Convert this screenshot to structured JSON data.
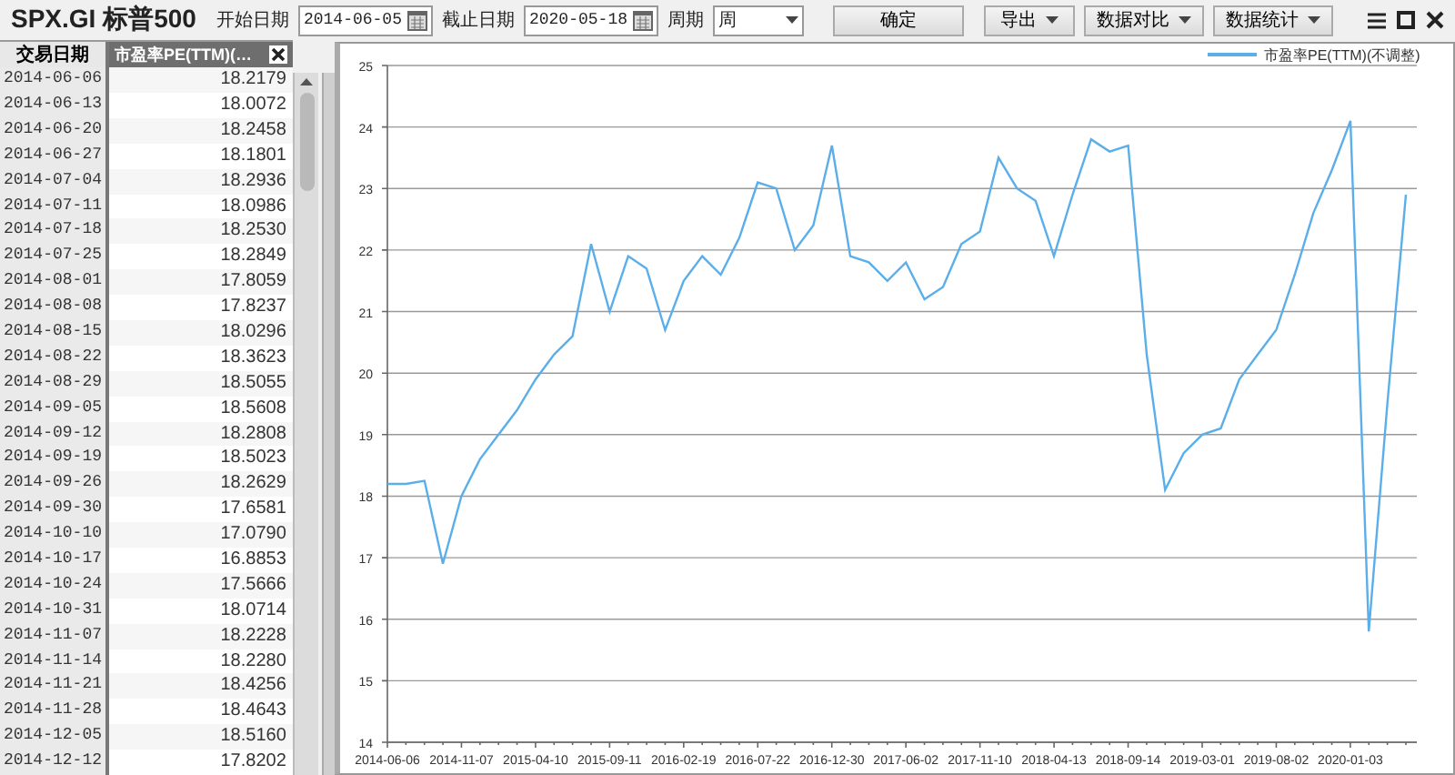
{
  "title": "SPX.GI 标普500",
  "toolbar": {
    "start_label": "开始日期",
    "start_value": "2014-06-05",
    "end_label": "截止日期",
    "end_value": "2020-05-18",
    "period_label": "周期",
    "period_value": "周",
    "buttons": [
      {
        "label": "确定",
        "dropdown": false
      },
      {
        "label": "导出",
        "dropdown": true
      },
      {
        "label": "数据对比",
        "dropdown": true
      },
      {
        "label": "数据统计",
        "dropdown": true
      }
    ]
  },
  "table": {
    "columns": [
      "交易日期",
      "市盈率PE(TTM)(…"
    ],
    "rows": [
      [
        "2014-06-06",
        "18.2179"
      ],
      [
        "2014-06-13",
        "18.0072"
      ],
      [
        "2014-06-20",
        "18.2458"
      ],
      [
        "2014-06-27",
        "18.1801"
      ],
      [
        "2014-07-04",
        "18.2936"
      ],
      [
        "2014-07-11",
        "18.0986"
      ],
      [
        "2014-07-18",
        "18.2530"
      ],
      [
        "2014-07-25",
        "18.2849"
      ],
      [
        "2014-08-01",
        "17.8059"
      ],
      [
        "2014-08-08",
        "17.8237"
      ],
      [
        "2014-08-15",
        "18.0296"
      ],
      [
        "2014-08-22",
        "18.3623"
      ],
      [
        "2014-08-29",
        "18.5055"
      ],
      [
        "2014-09-05",
        "18.5608"
      ],
      [
        "2014-09-12",
        "18.2808"
      ],
      [
        "2014-09-19",
        "18.5023"
      ],
      [
        "2014-09-26",
        "18.2629"
      ],
      [
        "2014-09-30",
        "17.6581"
      ],
      [
        "2014-10-10",
        "17.0790"
      ],
      [
        "2014-10-17",
        "16.8853"
      ],
      [
        "2014-10-24",
        "17.5666"
      ],
      [
        "2014-10-31",
        "18.0714"
      ],
      [
        "2014-11-07",
        "18.2228"
      ],
      [
        "2014-11-14",
        "18.2280"
      ],
      [
        "2014-11-21",
        "18.4256"
      ],
      [
        "2014-11-28",
        "18.4643"
      ],
      [
        "2014-12-05",
        "18.5160"
      ],
      [
        "2014-12-12",
        "17.8202"
      ]
    ]
  },
  "chart_data": {
    "type": "line",
    "grid": true,
    "ylim": [
      14,
      25
    ],
    "yticks": [
      14,
      15,
      16,
      17,
      18,
      19,
      20,
      21,
      22,
      23,
      24,
      25
    ],
    "categories": [
      "2014-06-06",
      null,
      null,
      null,
      "2014-11-07",
      null,
      null,
      null,
      "2015-04-10",
      null,
      null,
      null,
      "2015-09-11",
      null,
      null,
      null,
      "2016-02-19",
      null,
      null,
      null,
      "2016-07-22",
      null,
      null,
      null,
      "2016-12-30",
      null,
      null,
      null,
      "2017-06-02",
      null,
      null,
      null,
      "2017-11-10",
      null,
      null,
      null,
      "2018-04-13",
      null,
      null,
      null,
      "2018-09-14",
      null,
      null,
      null,
      "2019-03-01",
      null,
      null,
      null,
      "2019-08-02",
      null,
      null,
      null,
      "2020-01-03",
      null,
      null,
      null
    ],
    "series": [
      {
        "name": "市盈率PE(TTM)(不调整)",
        "color": "#5aaeea",
        "values": [
          18.2,
          18.2,
          18.25,
          16.9,
          18.0,
          18.6,
          19.0,
          19.4,
          19.9,
          20.3,
          20.6,
          22.1,
          21.0,
          21.9,
          21.7,
          20.7,
          21.5,
          21.9,
          21.6,
          22.2,
          23.1,
          23.0,
          22.0,
          22.4,
          23.7,
          21.9,
          21.8,
          21.5,
          21.8,
          21.2,
          21.4,
          22.1,
          22.3,
          23.5,
          23.0,
          22.8,
          21.9,
          22.9,
          23.8,
          23.6,
          23.7,
          20.3,
          18.1,
          18.7,
          19.0,
          19.1,
          19.9,
          20.3,
          20.7,
          21.6,
          22.6,
          23.3,
          24.1,
          15.8,
          19.5,
          22.9
        ]
      }
    ]
  }
}
